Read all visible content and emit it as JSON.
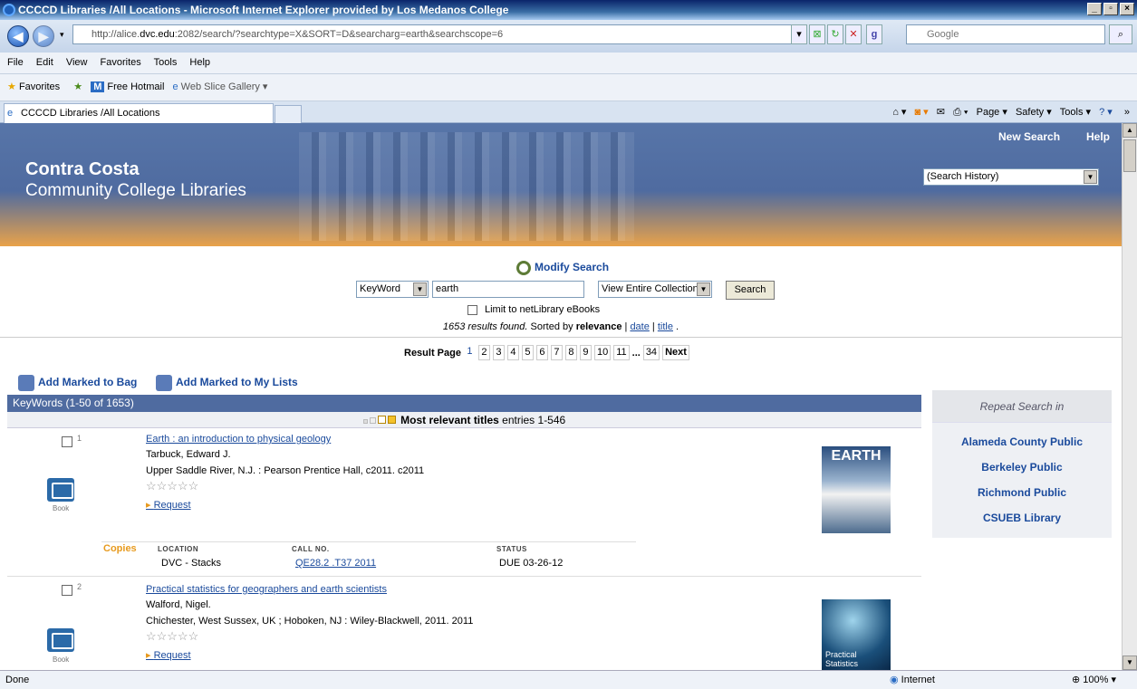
{
  "window": {
    "title": "CCCCD Libraries /All Locations - Microsoft Internet Explorer provided by Los Medanos College"
  },
  "browser": {
    "url_prefix": "http://alice.",
    "url_domain": "dvc.edu",
    "url_rest": ":2082/search/?searchtype=X&SORT=D&searcharg=earth&searchscope=6",
    "search_engine": "Google",
    "menus": [
      "File",
      "Edit",
      "View",
      "Favorites",
      "Tools",
      "Help"
    ],
    "favorites": {
      "label": "Favorites",
      "items": [
        "Free Hotmail",
        "Web Slice Gallery ▾"
      ]
    },
    "tab_title": "CCCCD Libraries /All Locations",
    "commands": [
      "Page ▾",
      "Safety ▾",
      "Tools ▾"
    ],
    "status": "Done",
    "zone": "Internet",
    "zoom": "100%"
  },
  "site": {
    "brand_line1": "Contra Costa",
    "brand_line2": "Community College Libraries",
    "new_search": "New Search",
    "help": "Help",
    "history_select": "(Search History)"
  },
  "search": {
    "modify_label": "Modify Search",
    "field_select": "KeyWord",
    "term": "earth",
    "scope_select": "View Entire Collection",
    "search_button": "Search",
    "limit_label": "Limit to netLibrary eBooks",
    "results_count": "1653 results found.",
    "sorted_prefix": " Sorted by ",
    "sorted_by": "relevance",
    "sort_sep": " | ",
    "sort_date": "date",
    "sort_title": "title",
    "sort_end": " ."
  },
  "pager": {
    "label": "Result Page",
    "current": "1",
    "pages": [
      "2",
      "3",
      "4",
      "5",
      "6",
      "7",
      "8",
      "9",
      "10",
      "11"
    ],
    "ellipsis": "...",
    "last": "34",
    "next": "Next"
  },
  "actions": {
    "add_bag": "Add Marked to Bag",
    "add_lists": "Add Marked to My Lists"
  },
  "results": {
    "header": "KeyWords (1-50 of 1653)",
    "relevance_label": "Most relevant titles",
    "relevance_range": " entries 1-546",
    "items": [
      {
        "num": "1",
        "title": "Earth : an introduction to physical geology",
        "author": "Tarbuck, Edward J.",
        "publisher": "Upper Saddle River, N.J. : Pearson Prentice Hall, c2011. c2011",
        "type": "Book",
        "request": "Request"
      },
      {
        "num": "2",
        "title": "Practical statistics for geographers and earth scientists",
        "author": "Walford, Nigel.",
        "publisher": "Chichester, West Sussex, UK ; Hoboken, NJ : Wiley-Blackwell, 2011. 2011",
        "type": "Book",
        "request": "Request"
      }
    ],
    "cover1_text": "EARTH",
    "cover2_text": "Practical Statistics",
    "copies": {
      "label": "Copies",
      "headers": [
        "LOCATION",
        "CALL NO.",
        "STATUS"
      ],
      "location": "DVC - Stacks",
      "call_no": "QE28.2 .T37 2011",
      "status": "DUE 03-26-12"
    }
  },
  "repeat_search": {
    "heading": "Repeat Search in",
    "links": [
      "Alameda County Public",
      "Berkeley Public",
      "Richmond Public",
      "CSUEB Library"
    ]
  }
}
